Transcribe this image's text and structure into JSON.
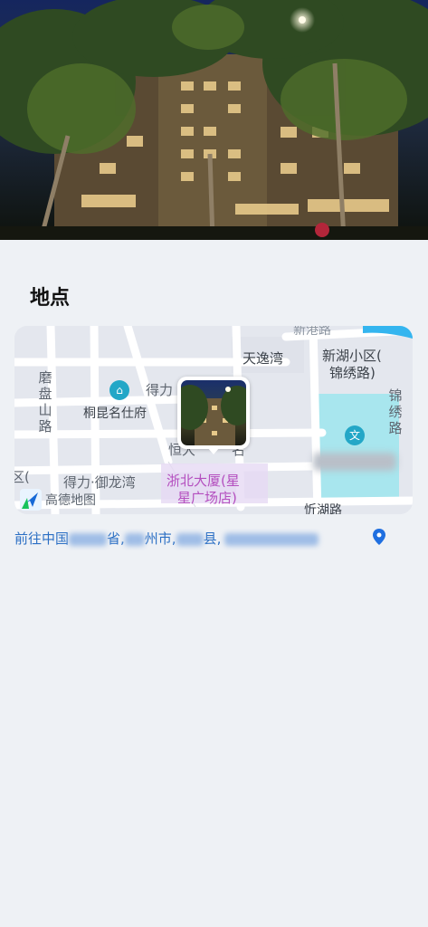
{
  "hero": {
    "image_description": ""
  },
  "section": {
    "title": "地点"
  },
  "map": {
    "labels": {
      "tianyiwan": "天逸湾",
      "xinhu_line1": "新湖小区(",
      "xinhu_line2": "锦绣路)",
      "mopanshan": "磨盘山路",
      "deli_top": "得力",
      "tongkun": "桐昆名仕府",
      "jinxiu": "锦绣路",
      "hengda": "恒大",
      "hengda_rest": "名",
      "deli_yulong": "得力·御龙湾",
      "zhebei_line1": "浙北大厦(星",
      "zhebei_line2": "星广场店)",
      "xinhu_road": "忻湖路",
      "left_edge": "区(",
      "top_road": "新港路",
      "poi_wen": "文"
    },
    "brand": "高德地图"
  },
  "address": {
    "prefix": "前往中国",
    "province_suffix": "省,",
    "city_suffix": "州市,",
    "county_suffix": "县,"
  },
  "colors": {
    "background": "#eef1f5",
    "map_park": "#a8e6ee",
    "link": "#2b6fc4",
    "poi_purple": "#b44fbf"
  }
}
